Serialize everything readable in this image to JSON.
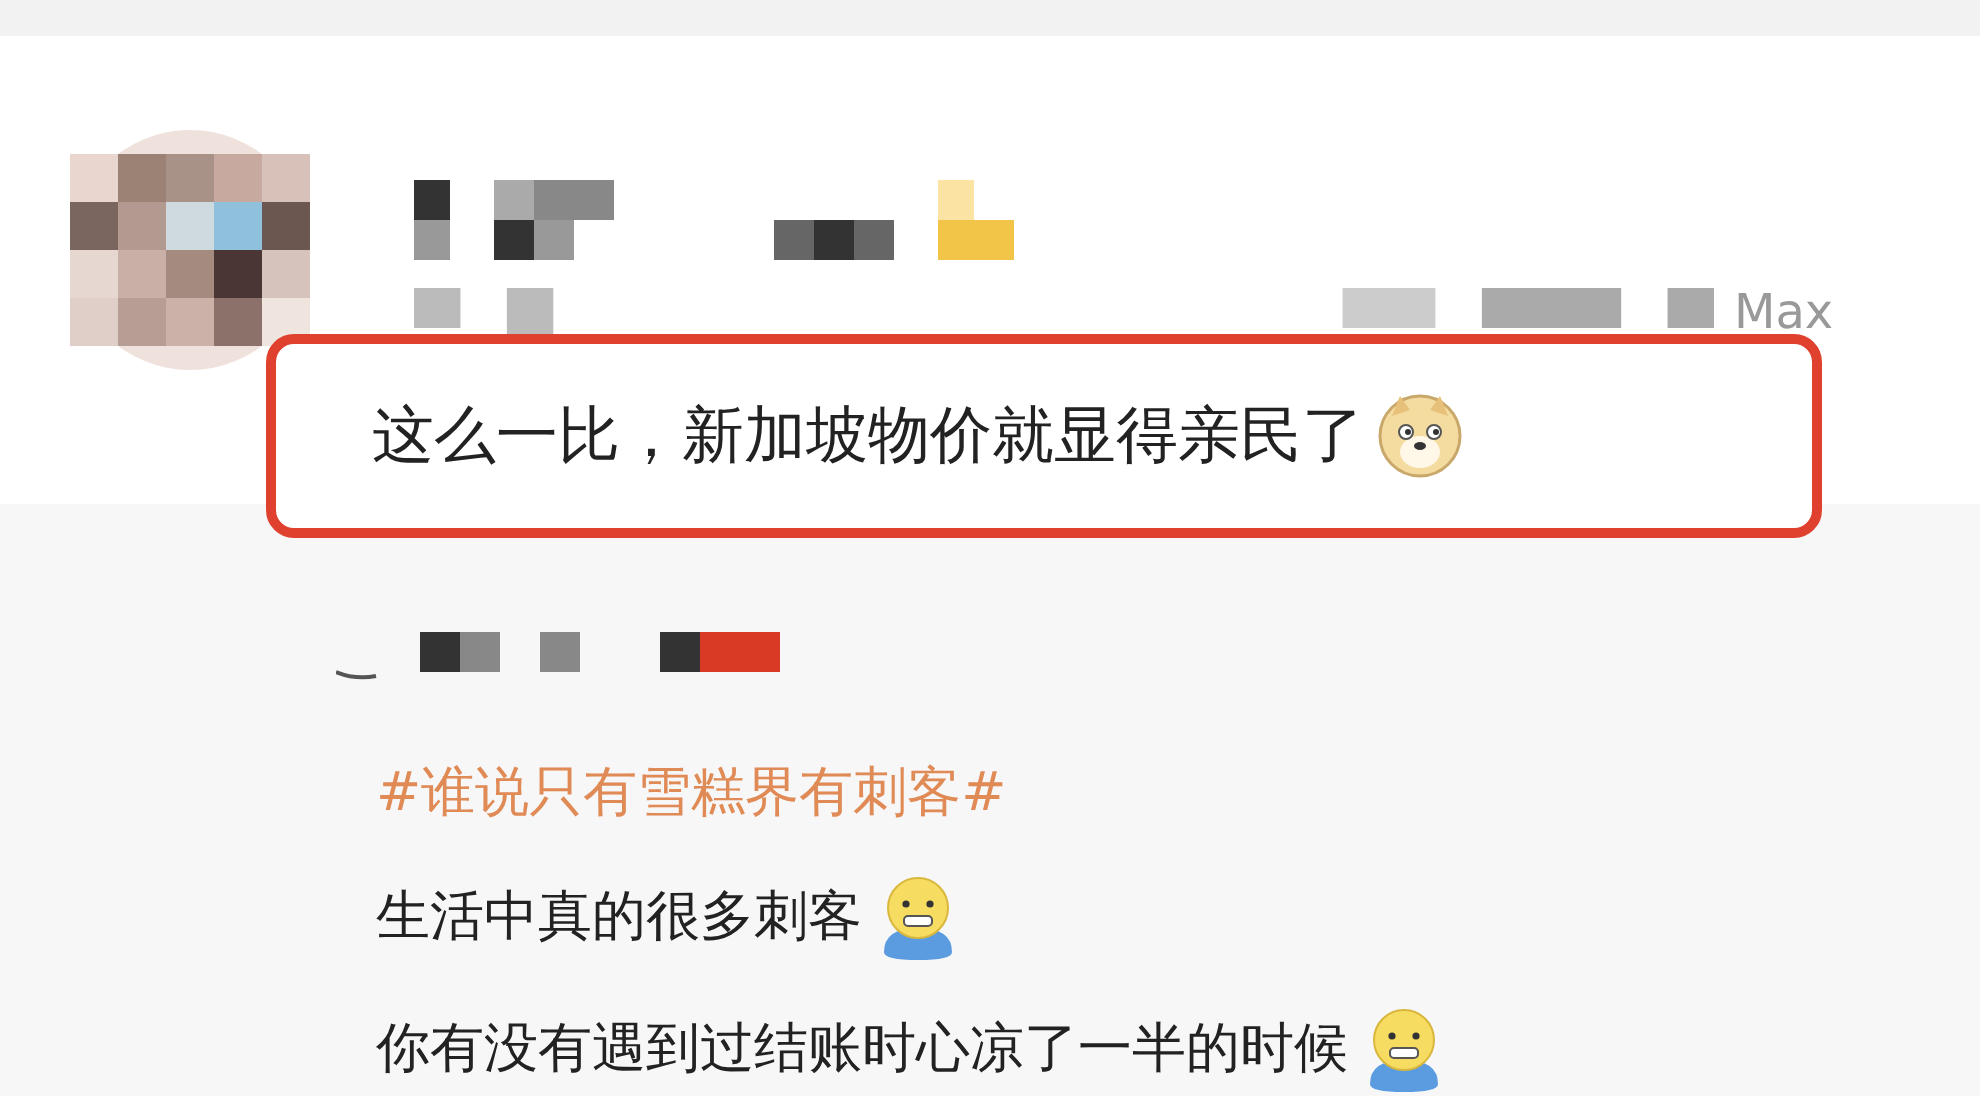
{
  "post": {
    "device_suffix": "Max",
    "quote": "这么一比，新加坡物价就显得亲民了"
  },
  "reply": {
    "hashtag": "#谁说只有雪糕界有刺客#",
    "lines": [
      "生活中真的很多刺客",
      "你有没有遇到过结账时心凉了一半的时候"
    ]
  }
}
